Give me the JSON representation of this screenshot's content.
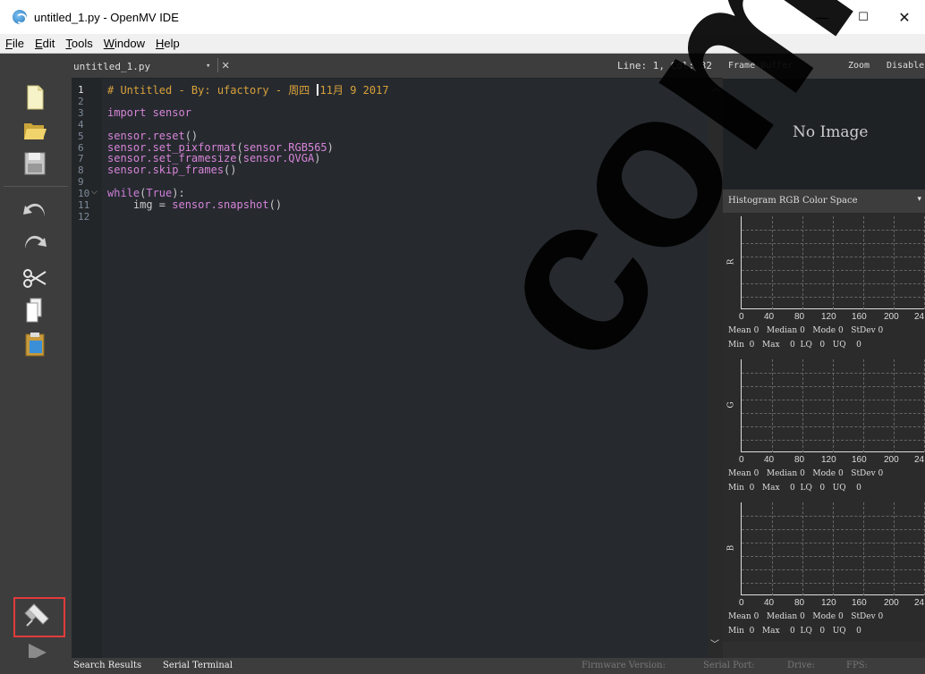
{
  "window": {
    "title": "untitled_1.py - OpenMV IDE",
    "minimize": "—",
    "maximize": "☐",
    "close": "✕"
  },
  "menu": [
    {
      "u": "F",
      "rest": "ile"
    },
    {
      "u": "E",
      "rest": "dit"
    },
    {
      "u": "T",
      "rest": "ools"
    },
    {
      "u": "W",
      "rest": "indow"
    },
    {
      "u": "H",
      "rest": "elp"
    }
  ],
  "toolbar": {
    "icons": [
      "new-file-icon",
      "open-file-icon",
      "save-icon",
      "undo-icon",
      "redo-icon",
      "cut-icon",
      "copy-icon",
      "paste-icon"
    ],
    "connect_icon": "usb-connect-icon",
    "run_icon": "run-icon"
  },
  "editor": {
    "file_name": "untitled_1.py",
    "combo_arrow": "▾",
    "close": "✕",
    "line_col": "Line: 1, Col: 32",
    "line_numbers": [
      "1",
      "2",
      "3",
      "4",
      "5",
      "6",
      "7",
      "8",
      "9",
      "10",
      "11",
      "12"
    ],
    "lines": [
      {
        "parts": [
          {
            "c": "c-comment",
            "t": "# Untitled - By: ufactory - 周四 "
          },
          {
            "cursor": true
          },
          {
            "c": "c-comment",
            "t": "11月 9 2017"
          }
        ]
      },
      {
        "parts": []
      },
      {
        "parts": [
          {
            "c": "c-import",
            "t": "import sensor"
          }
        ]
      },
      {
        "parts": []
      },
      {
        "parts": [
          {
            "c": "c-attr",
            "t": "sensor.reset"
          },
          {
            "c": "c-plain",
            "t": "()"
          }
        ]
      },
      {
        "parts": [
          {
            "c": "c-attr",
            "t": "sensor.set_pixformat"
          },
          {
            "c": "c-plain",
            "t": "("
          },
          {
            "c": "c-attr",
            "t": "sensor.RGB565"
          },
          {
            "c": "c-plain",
            "t": ")"
          }
        ]
      },
      {
        "parts": [
          {
            "c": "c-attr",
            "t": "sensor.set_framesize"
          },
          {
            "c": "c-plain",
            "t": "("
          },
          {
            "c": "c-attr",
            "t": "sensor.QVGA"
          },
          {
            "c": "c-plain",
            "t": ")"
          }
        ]
      },
      {
        "parts": [
          {
            "c": "c-attr",
            "t": "sensor.skip_frames"
          },
          {
            "c": "c-plain",
            "t": "()"
          }
        ]
      },
      {
        "parts": []
      },
      {
        "parts": [
          {
            "c": "c-kw",
            "t": "while"
          },
          {
            "c": "c-plain",
            "t": "("
          },
          {
            "c": "c-kw",
            "t": "True"
          },
          {
            "c": "c-plain",
            "t": "):"
          }
        ]
      },
      {
        "parts": [
          {
            "c": "c-plain",
            "t": "    img = "
          },
          {
            "c": "c-attr",
            "t": "sensor.snapshot"
          },
          {
            "c": "c-plain",
            "t": "()"
          }
        ]
      },
      {
        "parts": []
      }
    ]
  },
  "frame_buffer": {
    "label": "Frame Buffer",
    "zoom": "Zoom",
    "disable": "Disable",
    "no_image": "No Image"
  },
  "histogram": {
    "title": "Histogram  RGB Color Space",
    "arrow": "▾",
    "ticks": [
      "0",
      "40",
      "80",
      "120",
      "160",
      "200",
      "24"
    ],
    "channels": [
      {
        "name": "R",
        "stats1": "Mean 0   Median 0   Mode 0   StDev 0",
        "stats2": "Min  0   Max    0  LQ   0   UQ    0"
      },
      {
        "name": "G",
        "stats1": "Mean 0   Median 0   Mode 0   StDev 0",
        "stats2": "Min  0   Max    0  LQ   0   UQ    0"
      },
      {
        "name": "B",
        "stats1": "Mean 0   Median 0   Mode 0   StDev 0",
        "stats2": "Min  0   Max    0  LQ   0   UQ    0"
      }
    ]
  },
  "status": {
    "search_results": "Search Results",
    "serial_terminal": "Serial Terminal",
    "firmware": "Firmware Version:",
    "serial_port": "Serial Port:",
    "drive": "Drive:",
    "fps": "FPS:"
  },
  "watermark": "com",
  "colors": {
    "accent_highlight": "#e23b3b",
    "comment": "#d9a13a",
    "keyword": "#cf7ed8"
  }
}
